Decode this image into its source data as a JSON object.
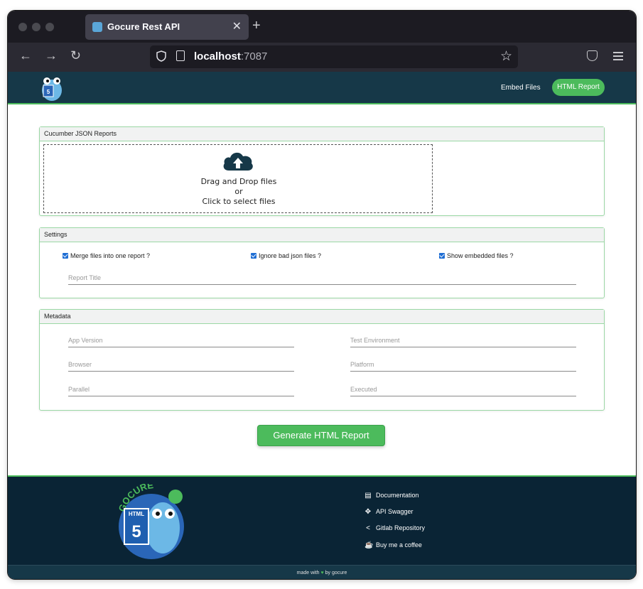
{
  "browser": {
    "tab_title": "Gocure Rest API",
    "url_host": "localhost",
    "url_port": ":7087"
  },
  "header": {
    "embed_link": "Embed Files",
    "report_button": "HTML Report"
  },
  "upload": {
    "title": "Cucumber JSON Reports",
    "line1": "Drag and Drop files",
    "line2": "or",
    "line3": "Click to select files"
  },
  "settings": {
    "title": "Settings",
    "merge_label": "Merge files into one report ?",
    "ignore_label": "Ignore bad json files ?",
    "show_label": "Show embedded files ?",
    "report_title_placeholder": "Report Title"
  },
  "metadata": {
    "title": "Metadata",
    "app_version": "App Version",
    "test_environment": "Test Environment",
    "browser": "Browser",
    "platform": "Platform",
    "parallel": "Parallel",
    "executed": "Executed"
  },
  "generate_button": "Generate HTML Report",
  "footer": {
    "links": [
      "Documentation",
      "API Swagger",
      "Gitlab Repository",
      "Buy me a coffee"
    ],
    "made_with": "made with",
    "by": "by gocure",
    "logo_text": "GOCURE"
  },
  "colors": {
    "brand_green": "#4cbb5c",
    "header_bg": "#163848",
    "footer_bg": "#0a2435"
  }
}
